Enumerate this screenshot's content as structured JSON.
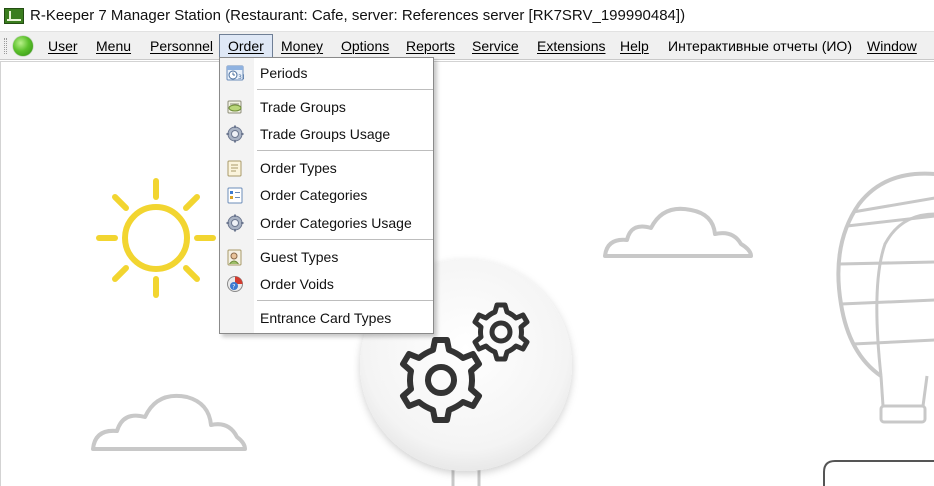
{
  "window": {
    "title": "R-Keeper 7 Manager Station (Restaurant: Cafe, server: References server [RK7SRV_199990484])",
    "app_icon_text": "r_k"
  },
  "menubar": {
    "items": [
      {
        "label": "User"
      },
      {
        "label": "Menu"
      },
      {
        "label": "Personnel"
      },
      {
        "label": "Order"
      },
      {
        "label": "Money"
      },
      {
        "label": "Options"
      },
      {
        "label": "Reports"
      },
      {
        "label": "Service"
      },
      {
        "label": "Extensions"
      },
      {
        "label": "Help"
      },
      {
        "label": "Интерактивные отчеты (ИО)"
      },
      {
        "label": "Window"
      }
    ],
    "active_item": "Order"
  },
  "order_menu": {
    "items": [
      {
        "label": "Periods",
        "icon": "calendar-clock-icon"
      },
      {
        "label": "Trade Groups",
        "icon": "trade-groups-icon"
      },
      {
        "label": "Trade Groups Usage",
        "icon": "gear-usage-icon"
      },
      {
        "label": "Order Types",
        "icon": "order-types-icon"
      },
      {
        "label": "Order Categories",
        "icon": "order-categories-icon"
      },
      {
        "label": "Order Categories Usage",
        "icon": "gear-usage-icon"
      },
      {
        "label": "Guest Types",
        "icon": "guest-types-icon"
      },
      {
        "label": "Order Voids",
        "icon": "order-voids-icon"
      },
      {
        "label": "Entrance Card Types",
        "icon": ""
      }
    ]
  },
  "colors": {
    "sun": "#f2d530",
    "line_art": "#c8c8c8",
    "gear": "#333333",
    "menubar_bg": "#f0f0f0",
    "active_menu_bg": "#dfe8f6"
  }
}
